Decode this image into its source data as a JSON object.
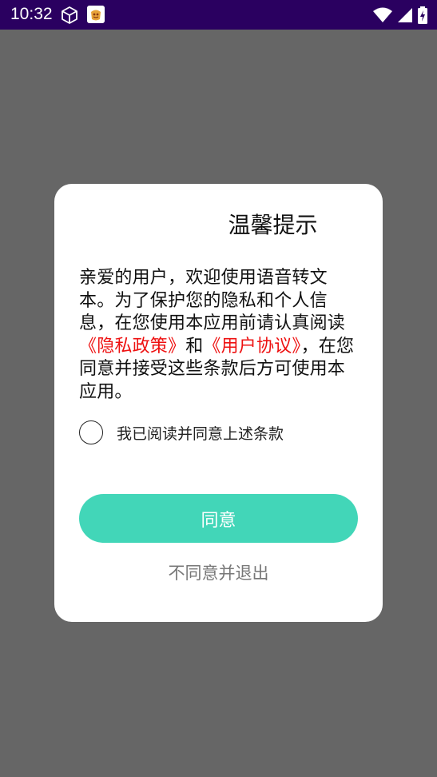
{
  "status_bar": {
    "time": "10:32",
    "icons": [
      "cube-icon",
      "app-notification-icon",
      "wifi-icon",
      "cellular-signal-icon",
      "battery-charging-icon"
    ]
  },
  "dialog": {
    "title": "温馨提示",
    "body_prefix": "亲爱的用户，欢迎使用语音转文本。为了保护您的隐私和个人信息，在您使用本应用前请认真阅读",
    "privacy_link": "《隐私政策》",
    "and_text": "和",
    "terms_link": "《用户协议》",
    "body_suffix": "，在您同意并接受这些条款后方可使用本应用。",
    "checkbox_label": "我已阅读并同意上述条款",
    "agree_label": "同意",
    "disagree_label": "不同意并退出"
  },
  "colors": {
    "accent": "#42d6b8",
    "link": "#ee1111",
    "status_bar": "#2a0060",
    "overlay": "#666666"
  }
}
